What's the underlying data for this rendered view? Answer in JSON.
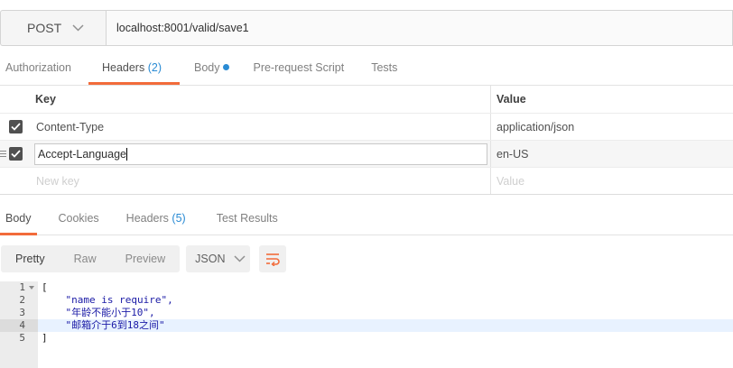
{
  "request": {
    "method": "POST",
    "url": "localhost:8001/valid/save1"
  },
  "request_tabs": [
    {
      "label": "Authorization"
    },
    {
      "label": "Headers",
      "count": "(2)"
    },
    {
      "label": "Body"
    },
    {
      "label": "Pre-request Script"
    },
    {
      "label": "Tests"
    }
  ],
  "headers_table": {
    "key_header": "Key",
    "value_header": "Value",
    "rows": [
      {
        "key": "Content-Type",
        "value": "application/json",
        "checked": true
      },
      {
        "key": "Accept-Language",
        "value": "en-US",
        "checked": true
      }
    ],
    "new_key_placeholder": "New key",
    "new_value_placeholder": "Value"
  },
  "response_tabs": [
    {
      "label": "Body"
    },
    {
      "label": "Cookies"
    },
    {
      "label": "Headers",
      "count": "(5)"
    },
    {
      "label": "Test Results"
    }
  ],
  "view_modes": [
    "Pretty",
    "Raw",
    "Preview"
  ],
  "format": "JSON",
  "code_lines": [
    {
      "n": "1",
      "text": "["
    },
    {
      "n": "2",
      "text": "    \"name is require\","
    },
    {
      "n": "3",
      "text": "    \"年龄不能小于10\","
    },
    {
      "n": "4",
      "text": "    \"邮箱介于6到18之间\""
    },
    {
      "n": "5",
      "text": "]"
    }
  ],
  "colors": {
    "accent": "#f26b3a",
    "count": "#2a8bd4",
    "string": "#1a1aa6"
  }
}
